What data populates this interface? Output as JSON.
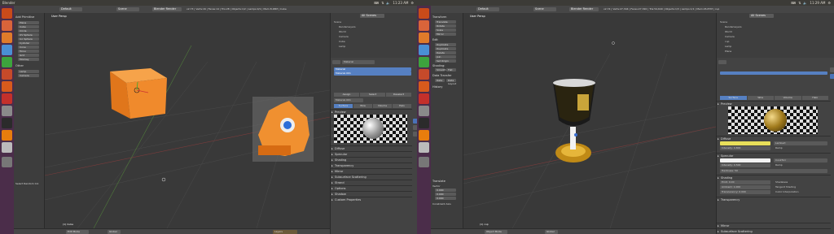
{
  "left": {
    "topbar": {
      "title": "Blender",
      "time": "11:23 AM"
    },
    "info": {
      "layout": "Default",
      "scene": "Scene",
      "engine": "Blender Render",
      "stats": "v2.73 | Verts:16 | Faces:14 | Tris:28 | Objects:1/2 | Lamps:0/1 | Mem:8.48M | Cube"
    },
    "tools": {
      "header": "Add Primitive",
      "items": [
        "Plane",
        "Cube",
        "Circle",
        "UV Sphere",
        "Ico Sphere",
        "Cylinder",
        "Cone",
        "Torus",
        "Grid",
        "Monkey"
      ],
      "other_header": "Other",
      "other_items": [
        "Lamp",
        "Camera"
      ],
      "footer": "Select Random Col"
    },
    "viewport": {
      "label": "User Persp",
      "object_name": "(1) Cube"
    },
    "header3d": {
      "mode": "Edit Mode",
      "pivot": "Global",
      "layer": "Layers"
    },
    "outliner": {
      "view": "All Scenes",
      "items": [
        "Scene",
        "RenderLayers",
        "World",
        "Camera",
        "Cube",
        "Lamp"
      ]
    },
    "properties": {
      "material_slot": "Material",
      "material_name": "Material.001",
      "slot_buttons": [
        "Assign",
        "Select",
        "Deselect"
      ],
      "preview_tabs": [
        "Surface",
        "Wire",
        "Volume",
        "Halo"
      ],
      "preview_label": "Preview",
      "sections": [
        "Diffuse",
        "Specular",
        "Shading",
        "Transparency",
        "Mirror",
        "Subsurface Scattering",
        "Strand",
        "Options",
        "Shadow",
        "Custom Properties"
      ]
    }
  },
  "right": {
    "topbar": {
      "time": "11:29 AM"
    },
    "info": {
      "layout": "Default",
      "scene": "Scene",
      "engine": "Blender Render",
      "stats": "v2.74 | Verts:27,344 | Faces:27,320 | Tris:54,640 | Objects:1/3 | Lamps:1/1 | Mem:26.87M | cup"
    },
    "tools": {
      "transform_header": "Transform",
      "transform_items": [
        "Translate",
        "Rotate",
        "Scale",
        "Mirror"
      ],
      "edit_header": "Edit",
      "edit_items": [
        "Duplicate",
        "Duplicate Linked",
        "Delete",
        "Join",
        "Set Origin"
      ],
      "shading_header": "Shading:",
      "shading_items": [
        "Smooth",
        "Flat"
      ],
      "data_header": "Data Transfer",
      "data_items": [
        "Data",
        "Data Layout"
      ],
      "history_header": "History",
      "operator": "Translate",
      "vector_label": "Vector",
      "vector": {
        "x": "0.000",
        "y": "0.000",
        "z": "0.000"
      },
      "constraint_label": "Constraint Axis"
    },
    "viewport": {
      "label": "User Persp",
      "object_name": "(1) cup"
    },
    "header3d": {
      "mode": "Object Mode",
      "pivot": "Global"
    },
    "outliner": {
      "view": "All Scenes",
      "items": [
        "Scene",
        "RenderLayers",
        "World",
        "Camera",
        "cup",
        "Lamp",
        "Plane"
      ]
    },
    "properties": {
      "preview_tabs": [
        "Surface",
        "Wire",
        "Volume",
        "Halo"
      ],
      "preview_label": "Preview",
      "diffuse_label": "Diffuse",
      "diffuse_model": "Lambert",
      "diffuse_intensity_label": "Intensity:",
      "diffuse_intensity": "0.800",
      "ramp_label": "Ramp",
      "specular_label": "Specular",
      "specular_model": "CookTorr",
      "specular_intensity_label": "Intensity:",
      "specular_intensity": "0.500",
      "hardness_label": "Hardness:",
      "hardness": "50",
      "shading_label": "Shading",
      "emit_label": "Emit:",
      "emit": "0.00",
      "ambient_label": "Ambient:",
      "ambient": "1.000",
      "translucency_label": "Translucency:",
      "translucency": "0.000",
      "shadeless_label": "Shadeless",
      "tangent_label": "Tangent Shading",
      "cubic_label": "Cubic Interpolation",
      "transparency_label": "Transparency",
      "sections": [
        "Mirror",
        "Subsurface Scattering"
      ]
    }
  },
  "colors": {
    "accent": "#f09030",
    "select": "#5680c2",
    "ubuntu_bar": "#3c3b37",
    "launcher": "#4b2d4a",
    "viewport": "#393939",
    "ui": "#434343"
  }
}
